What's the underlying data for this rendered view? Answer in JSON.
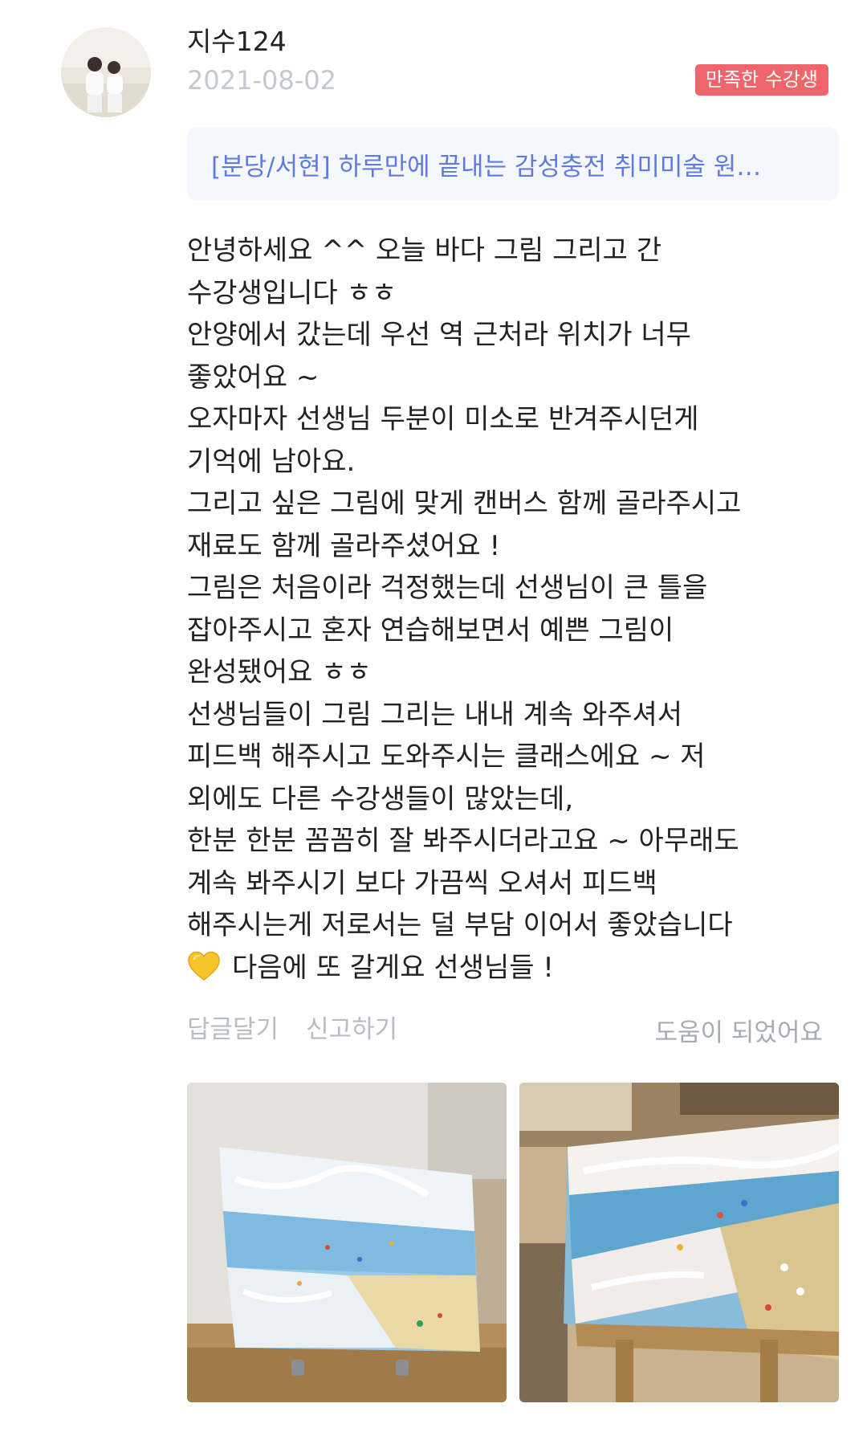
{
  "review": {
    "username": "지수124",
    "date": "2021-08-02",
    "badge": "만족한 수강생",
    "course_title": "[분당/서현] 하루만에 끝내는 감성충전 취미미술 원…",
    "body_lines": [
      "안녕하세요 ^^ 오늘 바다 그림 그리고 간",
      "수강생입니다 ㅎㅎ",
      "안양에서 갔는데 우선 역 근처라 위치가 너무",
      "좋았어요 ~",
      "오자마자 선생님 두분이 미소로 반겨주시던게",
      "기억에 남아요.",
      "그리고 싶은 그림에 맞게 캔버스 함께 골라주시고",
      "재료도 함께 골라주셨어요 !",
      "그림은 처음이라 걱정했는데 선생님이 큰 틀을",
      "잡아주시고 혼자 연습해보면서 예쁜 그림이",
      "완성됐어요 ㅎㅎ",
      "선생님들이 그림 그리는 내내 계속 와주셔서",
      "피드백 해주시고 도와주시는 클래스에요 ~ 저",
      "외에도 다른 수강생들이 많았는데,",
      "한분 한분 꼼꼼히 잘 봐주시더라고요 ~ 아무래도",
      "계속 봐주시기 보다 가끔씩 오셔서 피드백",
      "해주시는게 저로서는 덜 부담 이어서 좋았습니다",
      "다음에 또 갈게요 선생님들 !"
    ],
    "last_line_icon": "yellow-heart-icon",
    "actions": {
      "reply": "답글달기",
      "report": "신고하기",
      "helpful": "도움이 되었어요"
    }
  },
  "colors": {
    "badge_bg": "#f0656b",
    "course_text": "#5e7be0",
    "course_bg": "#f5f7fd",
    "muted_text": "#b8bcc3"
  }
}
